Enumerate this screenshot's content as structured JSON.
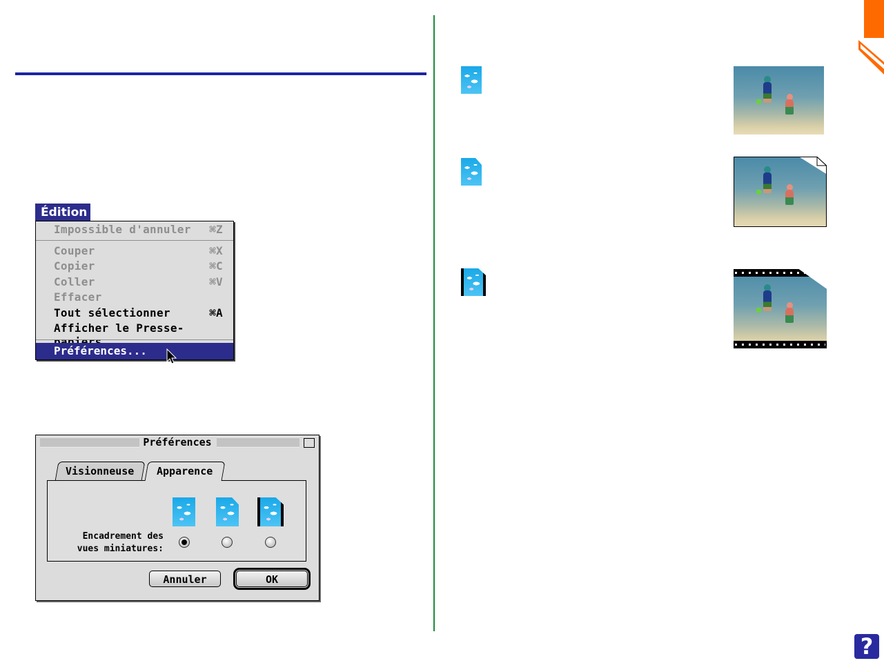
{
  "edit_menu": {
    "title": "Édition",
    "items": [
      {
        "label": "Impossible d'annuler",
        "shortcut": "⌘Z",
        "enabled": false
      },
      {
        "label": "Couper",
        "shortcut": "⌘X",
        "enabled": false
      },
      {
        "label": "Copier",
        "shortcut": "⌘C",
        "enabled": false
      },
      {
        "label": "Coller",
        "shortcut": "⌘V",
        "enabled": false
      },
      {
        "label": "Effacer",
        "shortcut": "",
        "enabled": false
      },
      {
        "label": "Tout sélectionner",
        "shortcut": "⌘A",
        "enabled": true
      },
      {
        "label": "Afficher le Presse-papiers",
        "shortcut": "",
        "enabled": true
      },
      {
        "label": "Préférences...",
        "shortcut": "",
        "enabled": true,
        "highlighted": true
      }
    ]
  },
  "preferences_dialog": {
    "title": "Préférences",
    "tabs": [
      {
        "label": "Visionneuse",
        "active": false
      },
      {
        "label": "Apparence",
        "active": true
      }
    ],
    "thumbnail_frame_label_line1": "Encadrement des",
    "thumbnail_frame_label_line2": "vues miniatures:",
    "options": [
      {
        "icon": "plain-thumbnail-icon",
        "selected": true
      },
      {
        "icon": "dogear-thumbnail-icon",
        "selected": false
      },
      {
        "icon": "filmstrip-thumbnail-icon",
        "selected": false
      }
    ],
    "cancel_label": "Annuler",
    "ok_label": "OK"
  },
  "help_button": {
    "label": "?"
  },
  "colors": {
    "menu_highlight": "#2c2c8c",
    "blue_rule": "#1a23a4",
    "green_rule": "#1f8a3a",
    "corner_tab": "#ff6a00"
  }
}
